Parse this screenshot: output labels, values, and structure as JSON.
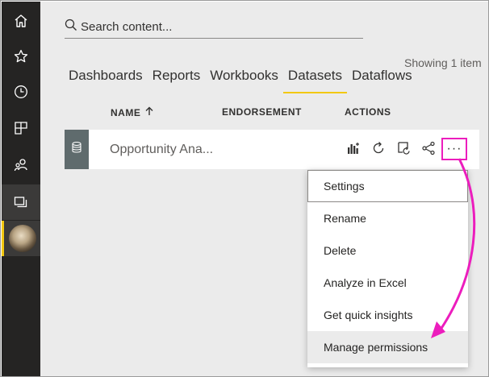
{
  "nav": {
    "items": [
      {
        "icon": "home-icon"
      },
      {
        "icon": "star-icon"
      },
      {
        "icon": "clock-icon"
      },
      {
        "icon": "apps-icon"
      },
      {
        "icon": "shared-icon"
      },
      {
        "icon": "workspaces-icon"
      }
    ],
    "selected": "workspaces-icon",
    "accent_color": "#f2c811"
  },
  "search": {
    "placeholder": "Search content..."
  },
  "status": {
    "showing": "Showing 1 item"
  },
  "tabs": [
    {
      "label": "Dashboards"
    },
    {
      "label": "Reports"
    },
    {
      "label": "Workbooks"
    },
    {
      "label": "Datasets",
      "active": true
    },
    {
      "label": "Dataflows"
    }
  ],
  "table": {
    "columns": {
      "name": "NAME",
      "name_sort_icon": "arrow-up-icon",
      "endorsement": "ENDORSEMENT",
      "actions": "ACTIONS"
    },
    "rows": [
      {
        "name": "Opportunity Ana...",
        "icon": "database-icon",
        "actions": [
          "create-report-icon",
          "refresh-icon",
          "schedule-refresh-icon",
          "share-icon",
          "more-options-icon"
        ],
        "more_label": "···"
      }
    ]
  },
  "context_menu": {
    "items": [
      {
        "label": "Settings"
      },
      {
        "label": "Rename"
      },
      {
        "label": "Delete"
      },
      {
        "label": "Analyze in Excel"
      },
      {
        "label": "Get quick insights"
      },
      {
        "label": "Manage permissions"
      }
    ],
    "focused_item": "Settings",
    "hovered_item": "Manage permissions"
  },
  "annotation_color": "#ec1dbd"
}
